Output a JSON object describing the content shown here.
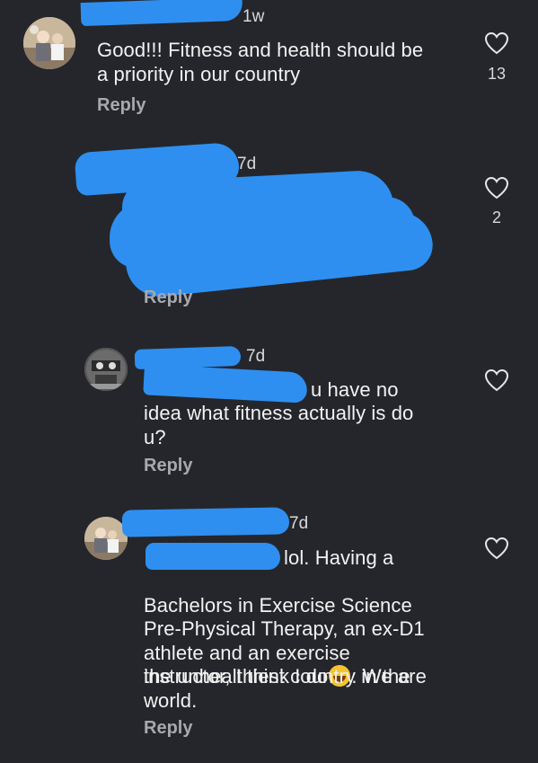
{
  "comments": [
    {
      "time": "1w",
      "text": "Good!!! Fitness and health should be\na priority in our country",
      "reply_label": "Reply",
      "like_count": "13"
    },
    {
      "time": "7d",
      "text": "",
      "reply_label": "Reply",
      "like_count": "2"
    },
    {
      "time": "7d",
      "text_suffix": "u have no",
      "text": "idea what fitness actually is do\nu?",
      "reply_label": "Reply",
      "like_count": ""
    },
    {
      "time": "7d",
      "text_first": "lol.  Having a",
      "text": "Bachelors in Exercise Science\nPre-Physical Therapy, an ex-D1\nathlete and an exercise\ninstructor, I think I do",
      "text_after_emoji": ". We are",
      "text_end": "the unhealthiest country in the\nworld.",
      "emoji": "rolling-on-floor-laughing",
      "reply_label": "Reply",
      "like_count": ""
    }
  ],
  "colors": {
    "background": "#25262c",
    "redaction": "#2e8ff0",
    "text": "#f2f2f2",
    "muted": "#a8a8ad"
  },
  "icons": {
    "like": "heart-outline-icon"
  }
}
